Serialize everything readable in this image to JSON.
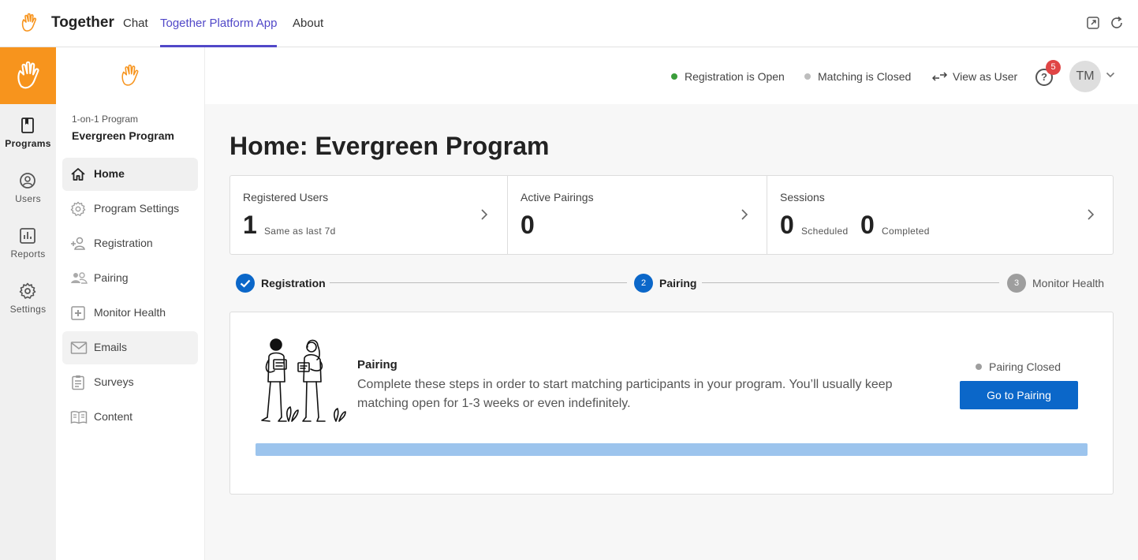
{
  "topbar": {
    "brand": "Together",
    "tabs": [
      {
        "label": "Chat"
      },
      {
        "label": "Together Platform App"
      },
      {
        "label": "About"
      }
    ],
    "accent": "#5148c8"
  },
  "rail": {
    "items": [
      {
        "label": "Programs",
        "icon": "book-icon"
      },
      {
        "label": "Users",
        "icon": "user-circle-icon"
      },
      {
        "label": "Reports",
        "icon": "bar-chart-icon"
      },
      {
        "label": "Settings",
        "icon": "gear-icon"
      }
    ],
    "brand_color": "#f7941d"
  },
  "program": {
    "kind": "1-on-1 Program",
    "name": "Evergreen Program",
    "nav": [
      {
        "label": "Home",
        "icon": "home-icon"
      },
      {
        "label": "Program Settings",
        "icon": "gear-icon"
      },
      {
        "label": "Registration",
        "icon": "add-user-icon"
      },
      {
        "label": "Pairing",
        "icon": "people-icon"
      },
      {
        "label": "Monitor Health",
        "icon": "plus-box-icon"
      },
      {
        "label": "Emails",
        "icon": "mail-icon"
      },
      {
        "label": "Surveys",
        "icon": "clipboard-icon"
      },
      {
        "label": "Content",
        "icon": "book-open-icon"
      }
    ]
  },
  "header": {
    "registration_status": "Registration is Open",
    "matching_status": "Matching is Closed",
    "view_as_user": "View as User",
    "notification_count": "5",
    "help_glyph": "?",
    "avatar_initials": "TM",
    "status_colors": {
      "open": "#3a9d3a",
      "closed": "#bdbdbd"
    }
  },
  "page": {
    "title": "Home: Evergreen Program"
  },
  "stats": {
    "registered": {
      "label": "Registered Users",
      "value": "1",
      "sub": "Same as last 7d"
    },
    "pairings": {
      "label": "Active Pairings",
      "value": "0"
    },
    "sessions": {
      "label": "Sessions",
      "scheduled_value": "0",
      "scheduled_label": "Scheduled",
      "completed_value": "0",
      "completed_label": "Completed"
    }
  },
  "stepper": {
    "steps": [
      {
        "label": "Registration",
        "state": "done"
      },
      {
        "number": "2",
        "label": "Pairing",
        "state": "current"
      },
      {
        "number": "3",
        "label": "Monitor Health",
        "state": "upcoming"
      }
    ],
    "colors": {
      "done": "#0b67c9",
      "current": "#0b67c9",
      "upcoming": "#9e9e9e"
    }
  },
  "pairing_card": {
    "title": "Pairing",
    "description": "Complete these steps in order to start matching participants in your program. You’ll usually keep matching open for 1-3 weeks or even indefinitely.",
    "status": "Pairing Closed",
    "button": "Go to Pairing",
    "progress_fraction": 1.0
  }
}
